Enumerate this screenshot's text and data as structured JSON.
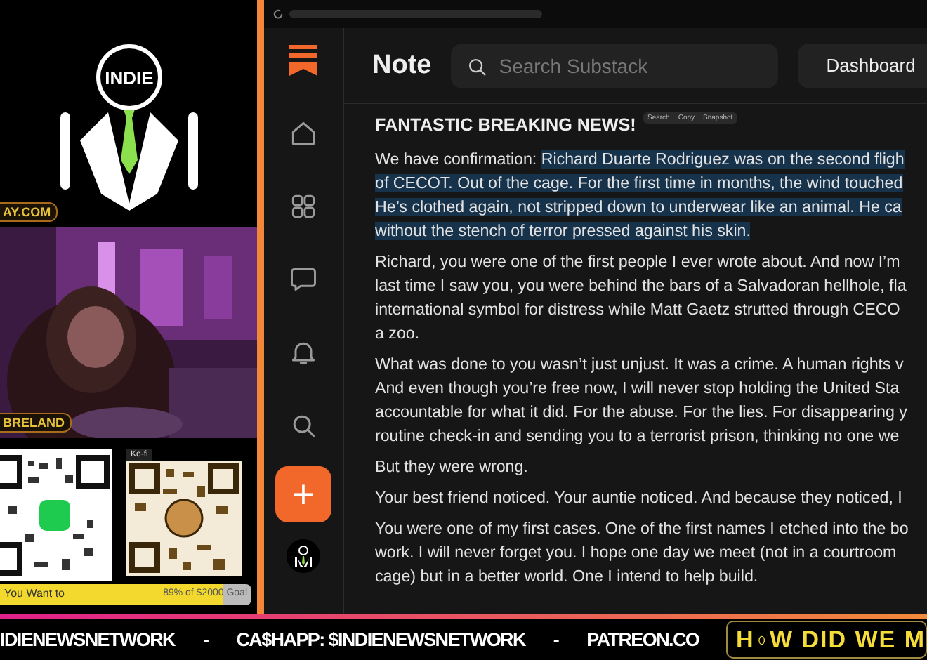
{
  "overlay": {
    "logo_text": "INDIE",
    "site_tag": "AY.COM",
    "name_tag": "BRELAND",
    "kofi_label": "Ko-fi",
    "goal": {
      "label": "You Want to",
      "reading": "89% of $2000 Goal",
      "level": 0.89
    }
  },
  "browser": {
    "app": {
      "title": "Note",
      "search": {
        "placeholder": "Search Substack"
      },
      "dashboard_button": "Dashboard",
      "sidebar": [
        {
          "kind": "logo"
        },
        {
          "kind": "home"
        },
        {
          "kind": "grid"
        },
        {
          "kind": "chat"
        },
        {
          "kind": "bell"
        },
        {
          "kind": "search"
        },
        {
          "kind": "compose",
          "label": "+"
        },
        {
          "kind": "avatar"
        }
      ],
      "context_menu": [
        "Search",
        "Copy",
        "Snapshot"
      ],
      "post": {
        "heading": "FANTASTIC BREAKING NEWS!",
        "paragraphs": [
          [
            [
              {
                "text": "We have confirmation: ",
                "selected": false
              },
              {
                "text": "Richard Duarte Rodriguez was on the second fligh",
                "selected": true
              }
            ],
            [
              {
                "text": "of CECOT. Out of the cage. For the first time in months, the wind touched",
                "selected": true
              }
            ],
            [
              {
                "text": "He’s clothed again, not stripped down to underwear like an animal. He ca",
                "selected": true
              }
            ],
            [
              {
                "text": "without the stench of terror pressed against his skin.",
                "selected": true
              }
            ]
          ],
          [
            [
              {
                "text": "Richard, you were one of the first people I ever wrote about. And now I’m",
                "selected": false
              }
            ],
            [
              {
                "text": "last time I saw you, you were behind the bars of a Salvadoran hellhole, fla",
                "selected": false
              }
            ],
            [
              {
                "text": "international symbol for distress while Matt Gaetz strutted through CECO",
                "selected": false
              }
            ],
            [
              {
                "text": "a zoo.",
                "selected": false
              }
            ]
          ],
          [
            [
              {
                "text": "What was done to you wasn’t just unjust. It was a crime. A human rights v",
                "selected": false
              }
            ],
            [
              {
                "text": "And even though you’re free now, I will never stop holding the United Sta",
                "selected": false
              }
            ],
            [
              {
                "text": "accountable for what it did. For the abuse. For the lies. For disappearing y",
                "selected": false
              }
            ],
            [
              {
                "text": "routine check-in and sending you to a terrorist prison, thinking no one we",
                "selected": false
              }
            ]
          ],
          [
            [
              {
                "text": "But they were wrong.",
                "selected": false
              }
            ]
          ],
          [
            [
              {
                "text": "Your best friend noticed. Your auntie noticed. And because they noticed, I",
                "selected": false
              }
            ]
          ],
          [
            [
              {
                "text": "You were one of my first cases. One of the first names I etched into the bo",
                "selected": false
              }
            ],
            [
              {
                "text": "work. I will never forget you. I hope one day we meet (not in a courtroom",
                "selected": false
              }
            ],
            [
              {
                "text": "cage) but in a better world. One I intend to help build.",
                "selected": false
              }
            ]
          ]
        ]
      }
    }
  },
  "ticker": {
    "items": [
      "IDIENEWSNETWORK",
      "-",
      "CA$HAPP: $INDIENEWSNETWORK",
      "-",
      "PATREON.CO"
    ],
    "banner": {
      "start": "H",
      "end": "W DID WE M"
    }
  }
}
